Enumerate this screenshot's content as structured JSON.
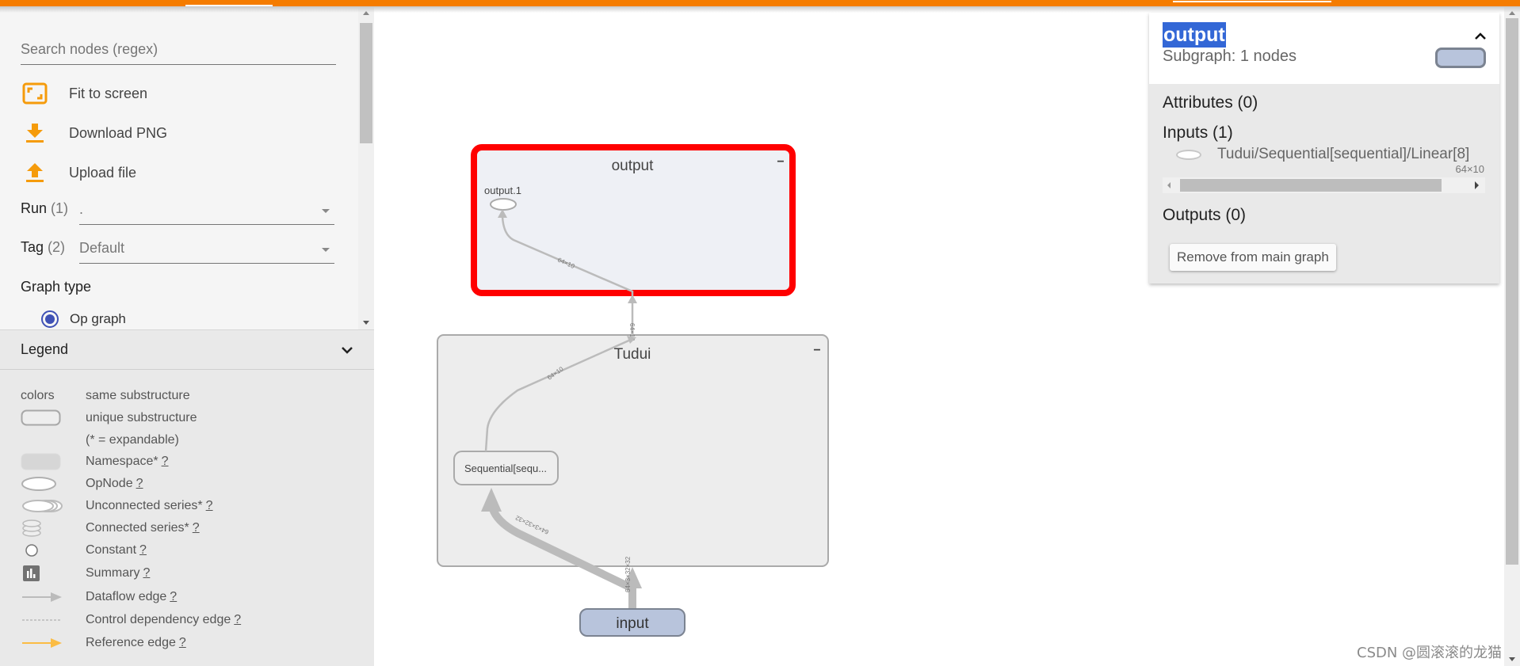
{
  "sidebar": {
    "search_placeholder": "Search nodes (regex)",
    "actions": [
      {
        "label": "Fit to screen",
        "icon": "fit-screen-icon"
      },
      {
        "label": "Download PNG",
        "icon": "download-icon"
      },
      {
        "label": "Upload file",
        "icon": "upload-icon"
      }
    ],
    "run": {
      "label": "Run",
      "count": "(1)",
      "value": "."
    },
    "tag": {
      "label": "Tag",
      "count": "(2)",
      "value": "Default"
    },
    "graph_type_label": "Graph type",
    "graph_type_selected": "Op graph",
    "accent_color": "#f57c00"
  },
  "legend": {
    "title": "Legend",
    "colors_label": "colors",
    "items": [
      {
        "label": "same substructure",
        "q": ""
      },
      {
        "label": "unique substructure",
        "q": ""
      },
      {
        "label": "(* = expandable)",
        "q": ""
      },
      {
        "label": "Namespace*",
        "q": "?"
      },
      {
        "label": "OpNode",
        "q": "?"
      },
      {
        "label": "Unconnected series*",
        "q": "?"
      },
      {
        "label": "Connected series*",
        "q": "?"
      },
      {
        "label": "Constant",
        "q": "?"
      },
      {
        "label": "Summary",
        "q": "?"
      },
      {
        "label": "Dataflow edge",
        "q": "?"
      },
      {
        "label": "Control dependency edge",
        "q": "?"
      },
      {
        "label": "Reference edge",
        "q": "?"
      }
    ]
  },
  "graph": {
    "nodes": {
      "output": {
        "title": "output",
        "child": "output.1",
        "selected": true,
        "highlight_color": "#ff0000"
      },
      "tudui": {
        "title": "Tudui",
        "child": "Sequential[sequ..."
      },
      "input": {
        "title": "input",
        "fill_color": "#b8c4dc"
      }
    },
    "edges": [
      {
        "from": "input",
        "to": "Sequential[sequential]",
        "label": "64×3×32×32"
      },
      {
        "from": "input",
        "to": "Tudui",
        "label": "64×3×32×32"
      },
      {
        "from": "Sequential[sequential]",
        "to": "Tudui",
        "label": "64×10"
      },
      {
        "from": "Tudui",
        "to": "output",
        "label": "64×10"
      },
      {
        "from": "output",
        "to": "output.1",
        "label": "64×10"
      }
    ],
    "collapse_symbol": "−"
  },
  "info_card": {
    "title": "output",
    "subtitle": "Subgraph: 1 nodes",
    "attributes": "Attributes (0)",
    "inputs": "Inputs (1)",
    "input_name": "Tudui/Sequential[sequential]/Linear[8]",
    "input_shape": "64×10",
    "outputs": "Outputs (0)",
    "remove_button": "Remove from main graph"
  },
  "watermark": "CSDN @圆滚滚的龙猫"
}
